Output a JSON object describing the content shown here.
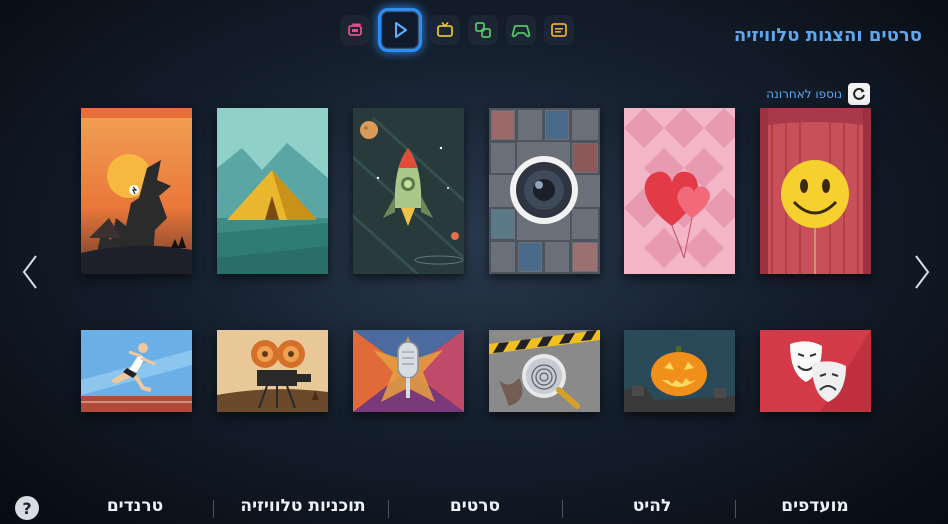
{
  "header": {
    "title": "סרטים והצגות טלוויזיה",
    "top_icons": [
      {
        "name": "multiview-icon",
        "color": "#e0508a"
      },
      {
        "name": "play-icon",
        "color": "#4aa3ff",
        "active": true
      },
      {
        "name": "tv-icon",
        "color": "#e6c040"
      },
      {
        "name": "source-icon",
        "color": "#52c46a"
      },
      {
        "name": "gamepad-icon",
        "color": "#52c46a"
      },
      {
        "name": "guide-icon",
        "color": "#e8a840"
      }
    ]
  },
  "recent": {
    "label": "נוספו לאחרונה"
  },
  "tiles_top": [
    {
      "name": "comedy-smiley-tile",
      "icon": "smiley-balloon"
    },
    {
      "name": "romance-hearts-tile",
      "icon": "heart-balloons"
    },
    {
      "name": "camera-lens-tile",
      "icon": "camera-lens"
    },
    {
      "name": "rocket-tile",
      "icon": "rocket"
    },
    {
      "name": "tent-tile",
      "icon": "tent"
    },
    {
      "name": "eagle-tile",
      "icon": "eagle"
    }
  ],
  "tiles_bottom": [
    {
      "name": "drama-masks-tile",
      "icon": "theater-masks"
    },
    {
      "name": "halloween-pumpkin-tile",
      "icon": "pumpkin"
    },
    {
      "name": "crime-fingerprint-tile",
      "icon": "magnifier-fingerprint"
    },
    {
      "name": "music-microphone-tile",
      "icon": "microphone-star"
    },
    {
      "name": "film-projector-tile",
      "icon": "projector"
    },
    {
      "name": "sports-runner-tile",
      "icon": "runner"
    }
  ],
  "nav": {
    "favorites": "מועדפים",
    "hits": "להיט",
    "movies": "סרטים",
    "tv_programs": "תוכניות טלוויזיה",
    "trends": "טרנדים"
  },
  "help_label": "?"
}
